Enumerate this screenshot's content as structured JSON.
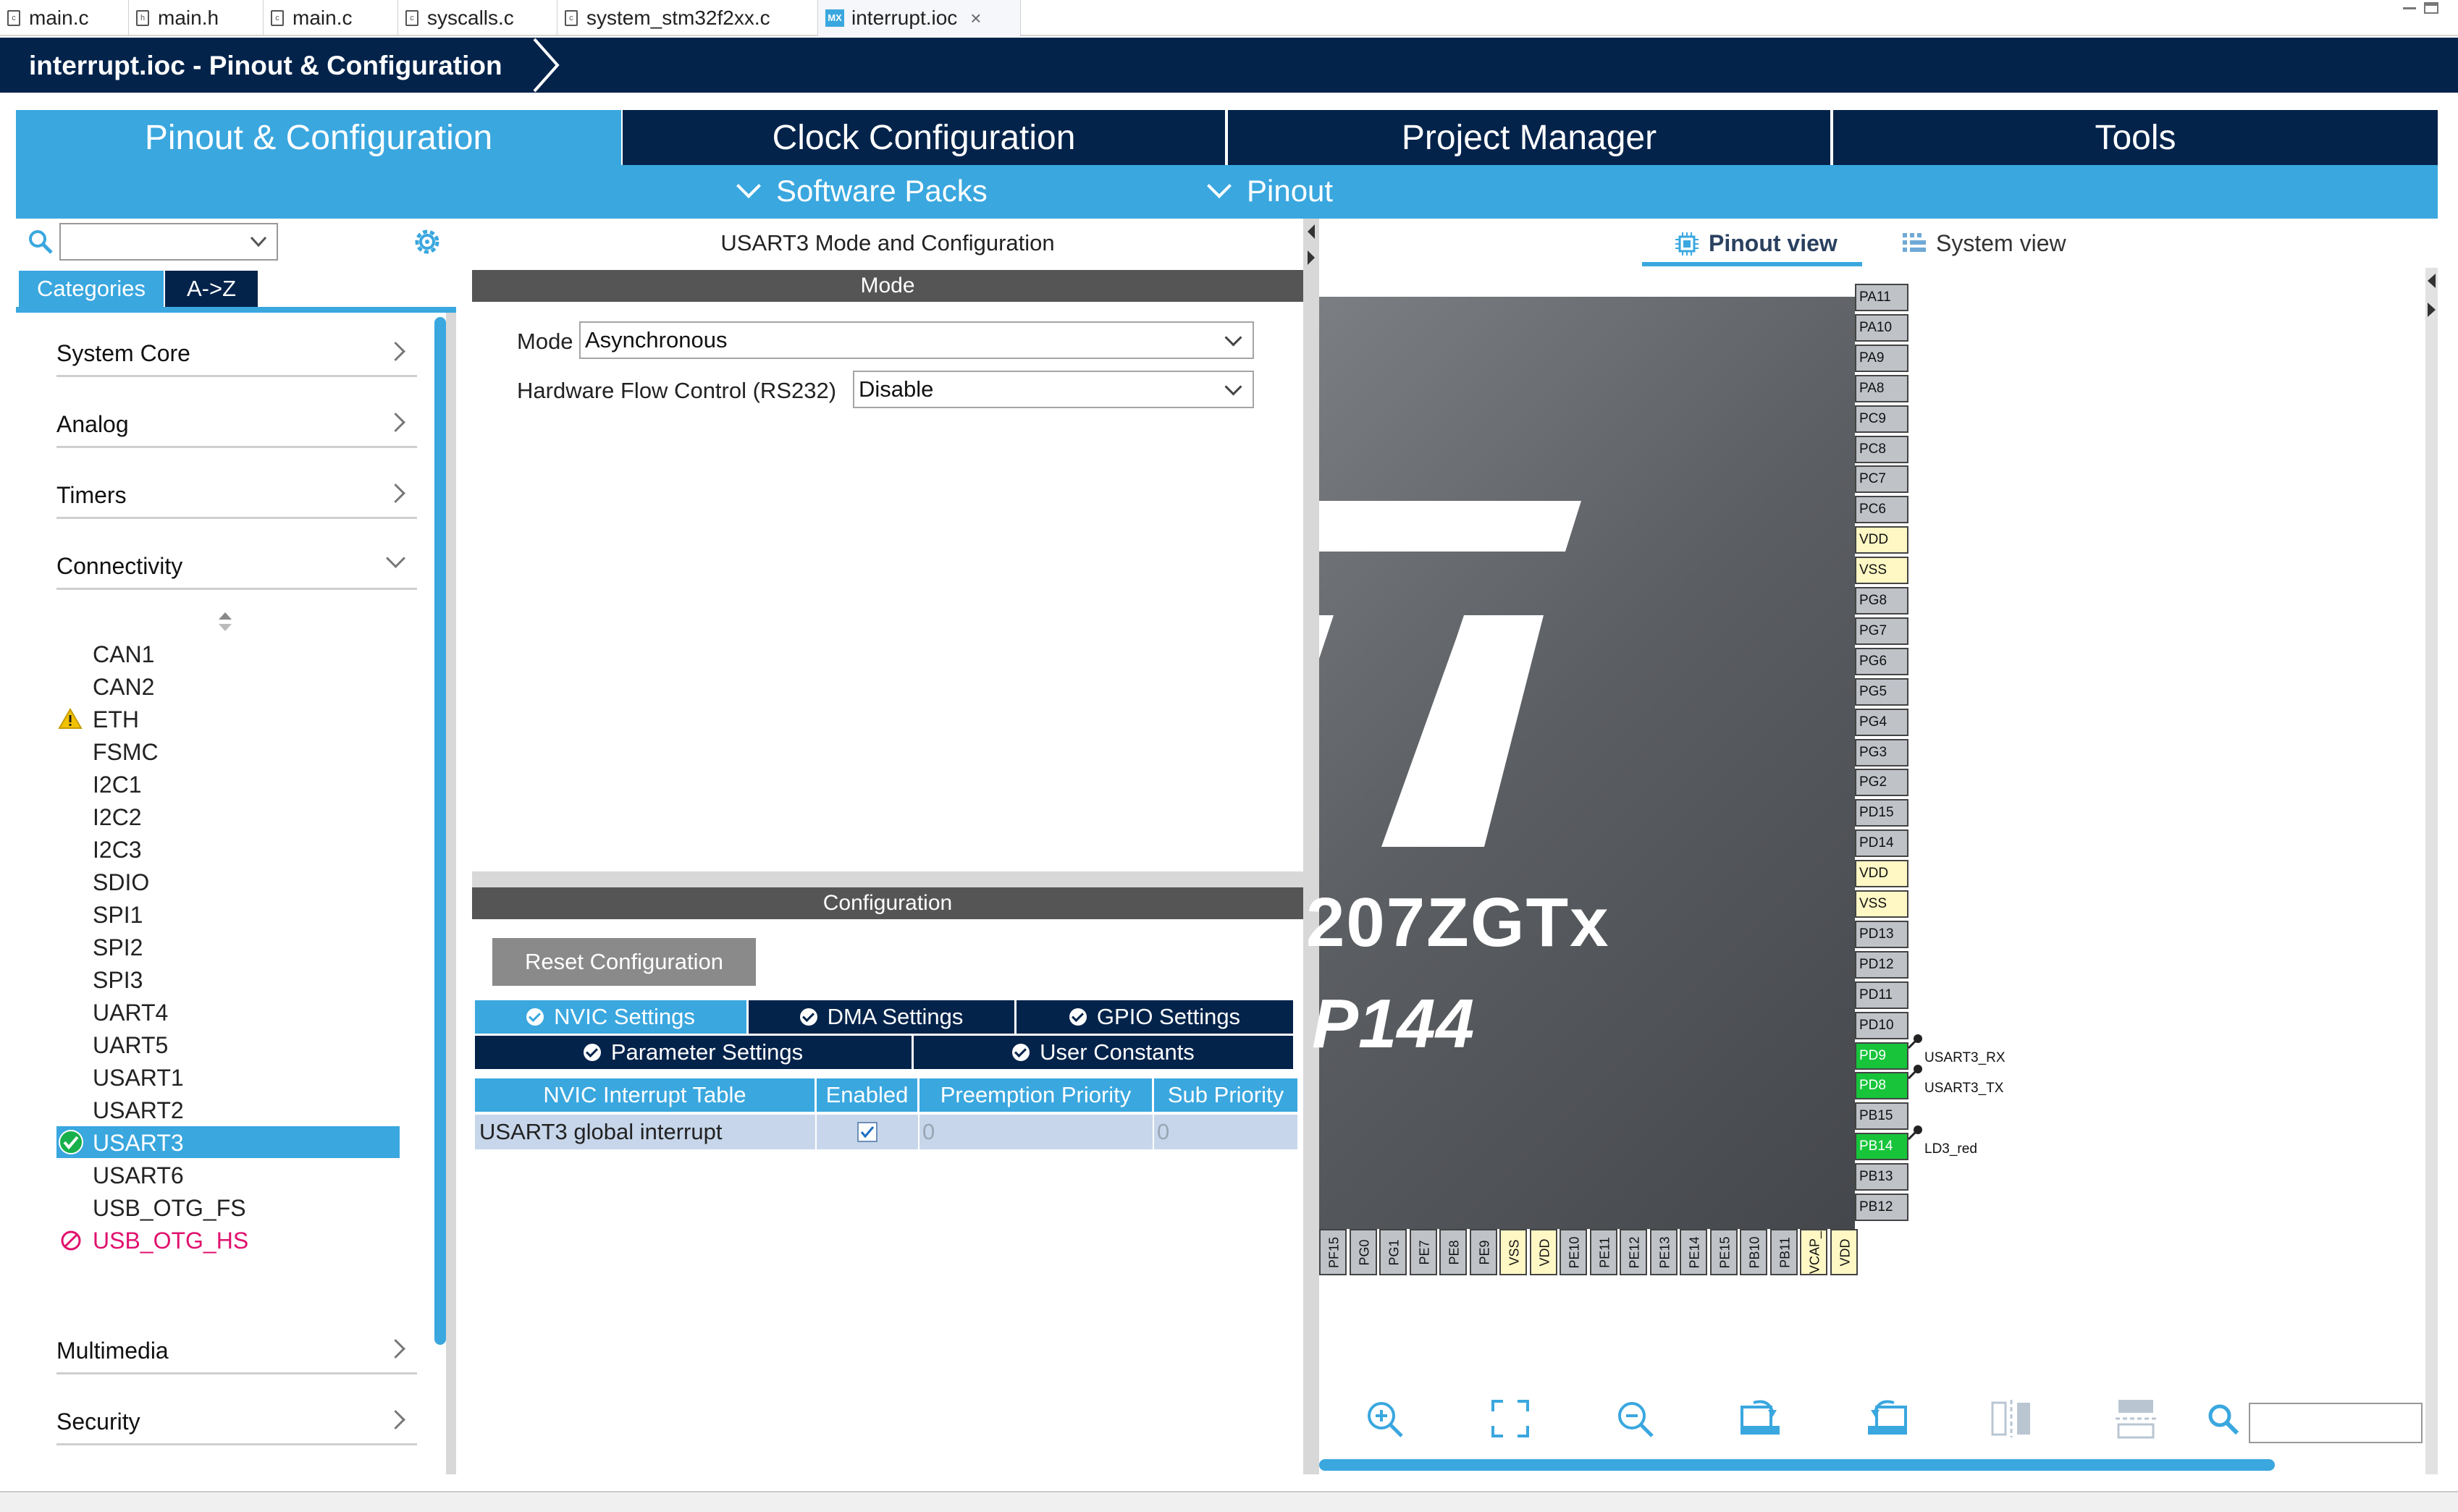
{
  "editor_tabs": [
    {
      "label": "main.c",
      "icon": "c-file-icon"
    },
    {
      "label": "main.h",
      "icon": "h-file-icon"
    },
    {
      "label": "main.c",
      "icon": "c-file-icon"
    },
    {
      "label": "syscalls.c",
      "icon": "c-file-icon"
    },
    {
      "label": "system_stm32f2xx.c",
      "icon": "c-file-icon"
    },
    {
      "label": "interrupt.ioc",
      "icon": "mx-file-icon",
      "mx_badge": "MX",
      "active": true
    }
  ],
  "title_bar": {
    "title": "interrupt.ioc - Pinout & Configuration"
  },
  "main_tabs": [
    {
      "label": "Pinout & Configuration",
      "active": true
    },
    {
      "label": "Clock Configuration"
    },
    {
      "label": "Project Manager"
    },
    {
      "label": "Tools"
    }
  ],
  "sub_menu": [
    {
      "label": "Software Packs"
    },
    {
      "label": "Pinout"
    }
  ],
  "left_panel": {
    "view_tabs": [
      {
        "label": "Categories",
        "active": true
      },
      {
        "label": "A->Z"
      }
    ],
    "categories": [
      {
        "label": "System Core",
        "expanded": false
      },
      {
        "label": "Analog",
        "expanded": false
      },
      {
        "label": "Timers",
        "expanded": false
      },
      {
        "label": "Connectivity",
        "expanded": true
      },
      {
        "label": "Multimedia",
        "expanded": false
      },
      {
        "label": "Security",
        "expanded": false
      }
    ],
    "connectivity_items": [
      {
        "label": "CAN1",
        "status": "none"
      },
      {
        "label": "CAN2",
        "status": "none"
      },
      {
        "label": "ETH",
        "status": "warning"
      },
      {
        "label": "FSMC",
        "status": "none"
      },
      {
        "label": "I2C1",
        "status": "none"
      },
      {
        "label": "I2C2",
        "status": "none"
      },
      {
        "label": "I2C3",
        "status": "none"
      },
      {
        "label": "SDIO",
        "status": "none"
      },
      {
        "label": "SPI1",
        "status": "none"
      },
      {
        "label": "SPI2",
        "status": "none"
      },
      {
        "label": "SPI3",
        "status": "none"
      },
      {
        "label": "UART4",
        "status": "none"
      },
      {
        "label": "UART5",
        "status": "none"
      },
      {
        "label": "USART1",
        "status": "none"
      },
      {
        "label": "USART2",
        "status": "none"
      },
      {
        "label": "USART3",
        "status": "ok",
        "selected": true
      },
      {
        "label": "USART6",
        "status": "none"
      },
      {
        "label": "USB_OTG_FS",
        "status": "none"
      },
      {
        "label": "USB_OTG_HS",
        "status": "unavailable"
      }
    ]
  },
  "middle_panel": {
    "title": "USART3 Mode and Configuration",
    "mode_header": "Mode",
    "mode_label": "Mode",
    "mode_value": "Asynchronous",
    "flow_label": "Hardware Flow Control (RS232)",
    "flow_value": "Disable",
    "config_header": "Configuration",
    "reset_button": "Reset Configuration",
    "settings_tabs_row1": [
      {
        "label": "NVIC Settings",
        "active": true
      },
      {
        "label": "DMA Settings"
      },
      {
        "label": "GPIO Settings"
      }
    ],
    "settings_tabs_row2": [
      {
        "label": "Parameter Settings"
      },
      {
        "label": "User Constants"
      }
    ],
    "nvic_table": {
      "headers": [
        "NVIC Interrupt Table",
        "Enabled",
        "Preemption Priority",
        "Sub Priority"
      ],
      "rows": [
        {
          "name": "USART3 global interrupt",
          "enabled": true,
          "preemption": "0",
          "sub": "0"
        }
      ]
    }
  },
  "right_panel": {
    "view_tabs": [
      {
        "label": "Pinout view",
        "active": true
      },
      {
        "label": "System view"
      }
    ],
    "chip_text_line1": "207ZGTx",
    "chip_text_line2": "P144",
    "right_pins": [
      {
        "name": "PA11",
        "type": "io"
      },
      {
        "name": "PA10",
        "type": "io"
      },
      {
        "name": "PA9",
        "type": "io"
      },
      {
        "name": "PA8",
        "type": "io"
      },
      {
        "name": "PC9",
        "type": "io"
      },
      {
        "name": "PC8",
        "type": "io"
      },
      {
        "name": "PC7",
        "type": "io"
      },
      {
        "name": "PC6",
        "type": "io"
      },
      {
        "name": "VDD",
        "type": "power"
      },
      {
        "name": "VSS",
        "type": "power"
      },
      {
        "name": "PG8",
        "type": "io"
      },
      {
        "name": "PG7",
        "type": "io"
      },
      {
        "name": "PG6",
        "type": "io"
      },
      {
        "name": "PG5",
        "type": "io"
      },
      {
        "name": "PG4",
        "type": "io"
      },
      {
        "name": "PG3",
        "type": "io"
      },
      {
        "name": "PG2",
        "type": "io"
      },
      {
        "name": "PD15",
        "type": "io"
      },
      {
        "name": "PD14",
        "type": "io"
      },
      {
        "name": "VDD",
        "type": "power"
      },
      {
        "name": "VSS",
        "type": "power"
      },
      {
        "name": "PD13",
        "type": "io"
      },
      {
        "name": "PD12",
        "type": "io"
      },
      {
        "name": "PD11",
        "type": "io"
      },
      {
        "name": "PD10",
        "type": "io"
      },
      {
        "name": "PD9",
        "type": "assigned",
        "signal": "USART3_RX"
      },
      {
        "name": "PD8",
        "type": "assigned",
        "signal": "USART3_TX"
      },
      {
        "name": "PB15",
        "type": "io"
      },
      {
        "name": "PB14",
        "type": "assigned",
        "signal": "LD3_red"
      },
      {
        "name": "PB13",
        "type": "io"
      },
      {
        "name": "PB12",
        "type": "io"
      }
    ],
    "bottom_pins": [
      {
        "name": "PF15",
        "type": "io"
      },
      {
        "name": "PG0",
        "type": "io"
      },
      {
        "name": "PG1",
        "type": "io"
      },
      {
        "name": "PE7",
        "type": "io"
      },
      {
        "name": "PE8",
        "type": "io"
      },
      {
        "name": "PE9",
        "type": "io"
      },
      {
        "name": "VSS",
        "type": "power"
      },
      {
        "name": "VDD",
        "type": "power"
      },
      {
        "name": "PE10",
        "type": "io"
      },
      {
        "name": "PE11",
        "type": "io"
      },
      {
        "name": "PE12",
        "type": "io"
      },
      {
        "name": "PE13",
        "type": "io"
      },
      {
        "name": "PE14",
        "type": "io"
      },
      {
        "name": "PE15",
        "type": "io"
      },
      {
        "name": "PB10",
        "type": "io"
      },
      {
        "name": "PB11",
        "type": "io"
      },
      {
        "name": "VCAP_",
        "type": "power"
      },
      {
        "name": "VDD",
        "type": "power"
      }
    ],
    "toolbar_icons": [
      "zoom-in-icon",
      "fit-screen-icon",
      "zoom-out-icon",
      "rotate-right-icon",
      "rotate-left-icon",
      "flip-vertical-icon",
      "flip-horizontal-icon",
      "search-icon"
    ]
  },
  "colors": {
    "accent": "#3aa7df",
    "navy": "#03234b",
    "assigned_pin": "#17c43a",
    "power_pin": "#fff7c4",
    "warning": "#f2c200",
    "error": "#e0116e"
  }
}
